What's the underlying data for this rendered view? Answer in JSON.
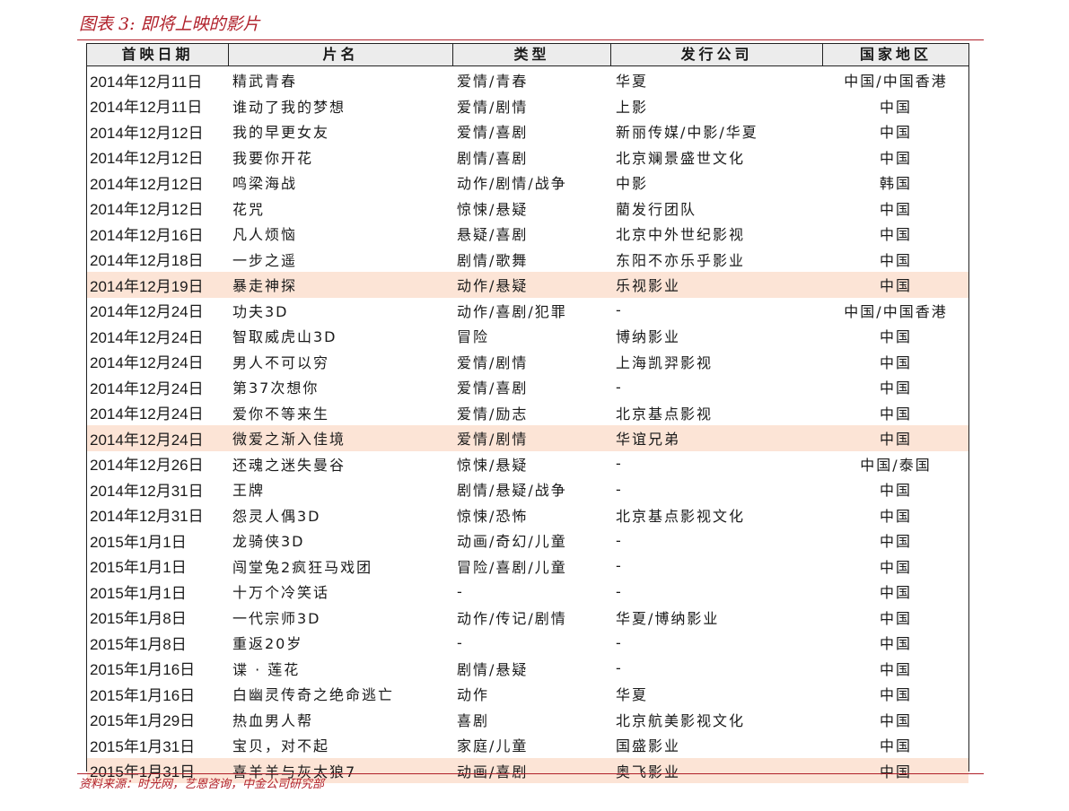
{
  "figure_title": "图表 3: 即将上映的影片",
  "source": "资料来源：时光网，艺恩咨询，中金公司研究部",
  "columns": [
    "首映日期",
    "片名",
    "类型",
    "发行公司",
    "国家地区"
  ],
  "rows": [
    {
      "date": "2014年12月11日",
      "title": "精武青春",
      "genre": "爱情/青春",
      "distributor": "华夏",
      "country": "中国/中国香港",
      "highlight": false
    },
    {
      "date": "2014年12月11日",
      "title": "谁动了我的梦想",
      "genre": "爱情/剧情",
      "distributor": "上影",
      "country": "中国",
      "highlight": false
    },
    {
      "date": "2014年12月12日",
      "title": "我的早更女友",
      "genre": "爱情/喜剧",
      "distributor": "新丽传媒/中影/华夏",
      "country": "中国",
      "highlight": false
    },
    {
      "date": "2014年12月12日",
      "title": "我要你开花",
      "genre": "剧情/喜剧",
      "distributor": "北京斓景盛世文化",
      "country": "中国",
      "highlight": false
    },
    {
      "date": "2014年12月12日",
      "title": "鸣梁海战",
      "genre": "动作/剧情/战争",
      "distributor": "中影",
      "country": "韩国",
      "highlight": false
    },
    {
      "date": "2014年12月12日",
      "title": "花咒",
      "genre": "惊悚/悬疑",
      "distributor": "藺发行团队",
      "country": "中国",
      "highlight": false
    },
    {
      "date": "2014年12月16日",
      "title": "凡人烦恼",
      "genre": "悬疑/喜剧",
      "distributor": "北京中外世纪影视",
      "country": "中国",
      "highlight": false
    },
    {
      "date": "2014年12月18日",
      "title": "一步之遥",
      "genre": "剧情/歌舞",
      "distributor": "东阳不亦乐乎影业",
      "country": "中国",
      "highlight": false
    },
    {
      "date": "2014年12月19日",
      "title": "暴走神探",
      "genre": "动作/悬疑",
      "distributor": "乐视影业",
      "country": "中国",
      "highlight": true
    },
    {
      "date": "2014年12月24日",
      "title": "功夫3D",
      "genre": "动作/喜剧/犯罪",
      "distributor": "-",
      "country": "中国/中国香港",
      "highlight": false
    },
    {
      "date": "2014年12月24日",
      "title": "智取威虎山3D",
      "genre": "冒险",
      "distributor": "博纳影业",
      "country": "中国",
      "highlight": false
    },
    {
      "date": "2014年12月24日",
      "title": "男人不可以穷",
      "genre": "爱情/剧情",
      "distributor": "上海凯羿影视",
      "country": "中国",
      "highlight": false
    },
    {
      "date": "2014年12月24日",
      "title": "第37次想你",
      "genre": "爱情/喜剧",
      "distributor": "-",
      "country": "中国",
      "highlight": false
    },
    {
      "date": "2014年12月24日",
      "title": "爱你不等来生",
      "genre": "爱情/励志",
      "distributor": "北京基点影视",
      "country": "中国",
      "highlight": false
    },
    {
      "date": "2014年12月24日",
      "title": "微爱之渐入佳境",
      "genre": "爱情/剧情",
      "distributor": "华谊兄弟",
      "country": "中国",
      "highlight": true
    },
    {
      "date": "2014年12月26日",
      "title": "还魂之迷失曼谷",
      "genre": "惊悚/悬疑",
      "distributor": "-",
      "country": "中国/泰国",
      "highlight": false
    },
    {
      "date": "2014年12月31日",
      "title": "王牌",
      "genre": "剧情/悬疑/战争",
      "distributor": "-",
      "country": "中国",
      "highlight": false
    },
    {
      "date": "2014年12月31日",
      "title": "怨灵人偶3D",
      "genre": "惊悚/恐怖",
      "distributor": "北京基点影视文化",
      "country": "中国",
      "highlight": false
    },
    {
      "date": "2015年1月1日",
      "title": "龙骑侠3D",
      "genre": "动画/奇幻/儿童",
      "distributor": "-",
      "country": "中国",
      "highlight": false
    },
    {
      "date": "2015年1月1日",
      "title": "闯堂兔2疯狂马戏团",
      "genre": "冒险/喜剧/儿童",
      "distributor": "-",
      "country": "中国",
      "highlight": false
    },
    {
      "date": "2015年1月1日",
      "title": "十万个冷笑话",
      "genre": "-",
      "distributor": "-",
      "country": "中国",
      "highlight": false
    },
    {
      "date": "2015年1月8日",
      "title": "一代宗师3D",
      "genre": "动作/传记/剧情",
      "distributor": "华夏/博纳影业",
      "country": "中国",
      "highlight": false
    },
    {
      "date": "2015年1月8日",
      "title": "重返20岁",
      "genre": "-",
      "distributor": "-",
      "country": "中国",
      "highlight": false
    },
    {
      "date": "2015年1月16日",
      "title": "谍 · 莲花",
      "genre": "剧情/悬疑",
      "distributor": "-",
      "country": "中国",
      "highlight": false
    },
    {
      "date": "2015年1月16日",
      "title": "白幽灵传奇之绝命逃亡",
      "genre": "动作",
      "distributor": "华夏",
      "country": "中国",
      "highlight": false
    },
    {
      "date": "2015年1月29日",
      "title": "热血男人帮",
      "genre": "喜剧",
      "distributor": "北京航美影视文化",
      "country": "中国",
      "highlight": false
    },
    {
      "date": "2015年1月31日",
      "title": "宝贝，对不起",
      "genre": "家庭/儿童",
      "distributor": "国盛影业",
      "country": "中国",
      "highlight": false
    },
    {
      "date": "2015年1月31日",
      "title": "喜羊羊与灰太狼7",
      "genre": "动画/喜剧",
      "distributor": "奥飞影业",
      "country": "中国",
      "highlight": true
    }
  ]
}
